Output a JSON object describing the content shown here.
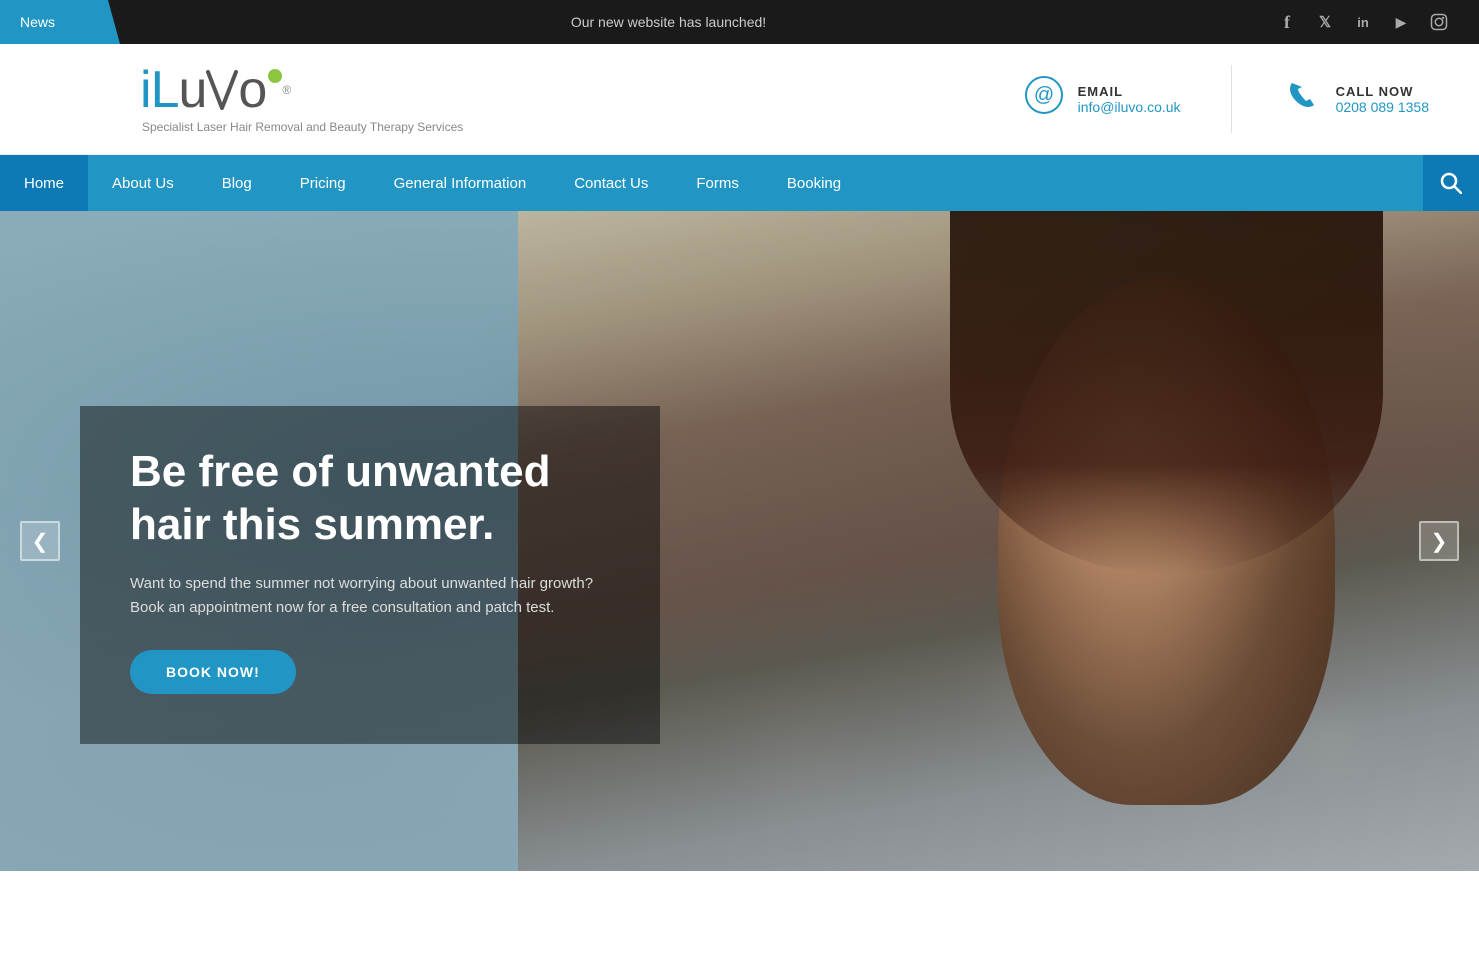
{
  "topbar": {
    "news_label": "News",
    "announcement": "Our new website has launched!",
    "social": [
      {
        "name": "facebook-icon",
        "symbol": "f"
      },
      {
        "name": "twitter-icon",
        "symbol": "𝕏"
      },
      {
        "name": "linkedin-icon",
        "symbol": "in"
      },
      {
        "name": "youtube-icon",
        "symbol": "▶"
      },
      {
        "name": "instagram-icon",
        "symbol": "📷"
      }
    ]
  },
  "header": {
    "logo_tagline": "Specialist Laser Hair Removal and Beauty Therapy Services",
    "email_label": "EMAIL",
    "email_value": "info@iluvo.co.uk",
    "phone_label": "CALL NOW",
    "phone_value": "0208 089 1358"
  },
  "nav": {
    "items": [
      {
        "label": "Home",
        "active": true
      },
      {
        "label": "About Us",
        "active": false
      },
      {
        "label": "Blog",
        "active": false
      },
      {
        "label": "Pricing",
        "active": false
      },
      {
        "label": "General Information",
        "active": false
      },
      {
        "label": "Contact Us",
        "active": false
      },
      {
        "label": "Forms",
        "active": false
      },
      {
        "label": "Booking",
        "active": false
      }
    ],
    "search_label": "🔍"
  },
  "hero": {
    "title": "Be free of unwanted hair this summer.",
    "subtitle": "Want to spend the summer not worrying about unwanted hair growth? Book an appointment now for a free consultation and patch test.",
    "cta_label": "BOOK NOW!",
    "prev_label": "❮",
    "next_label": "❯"
  }
}
